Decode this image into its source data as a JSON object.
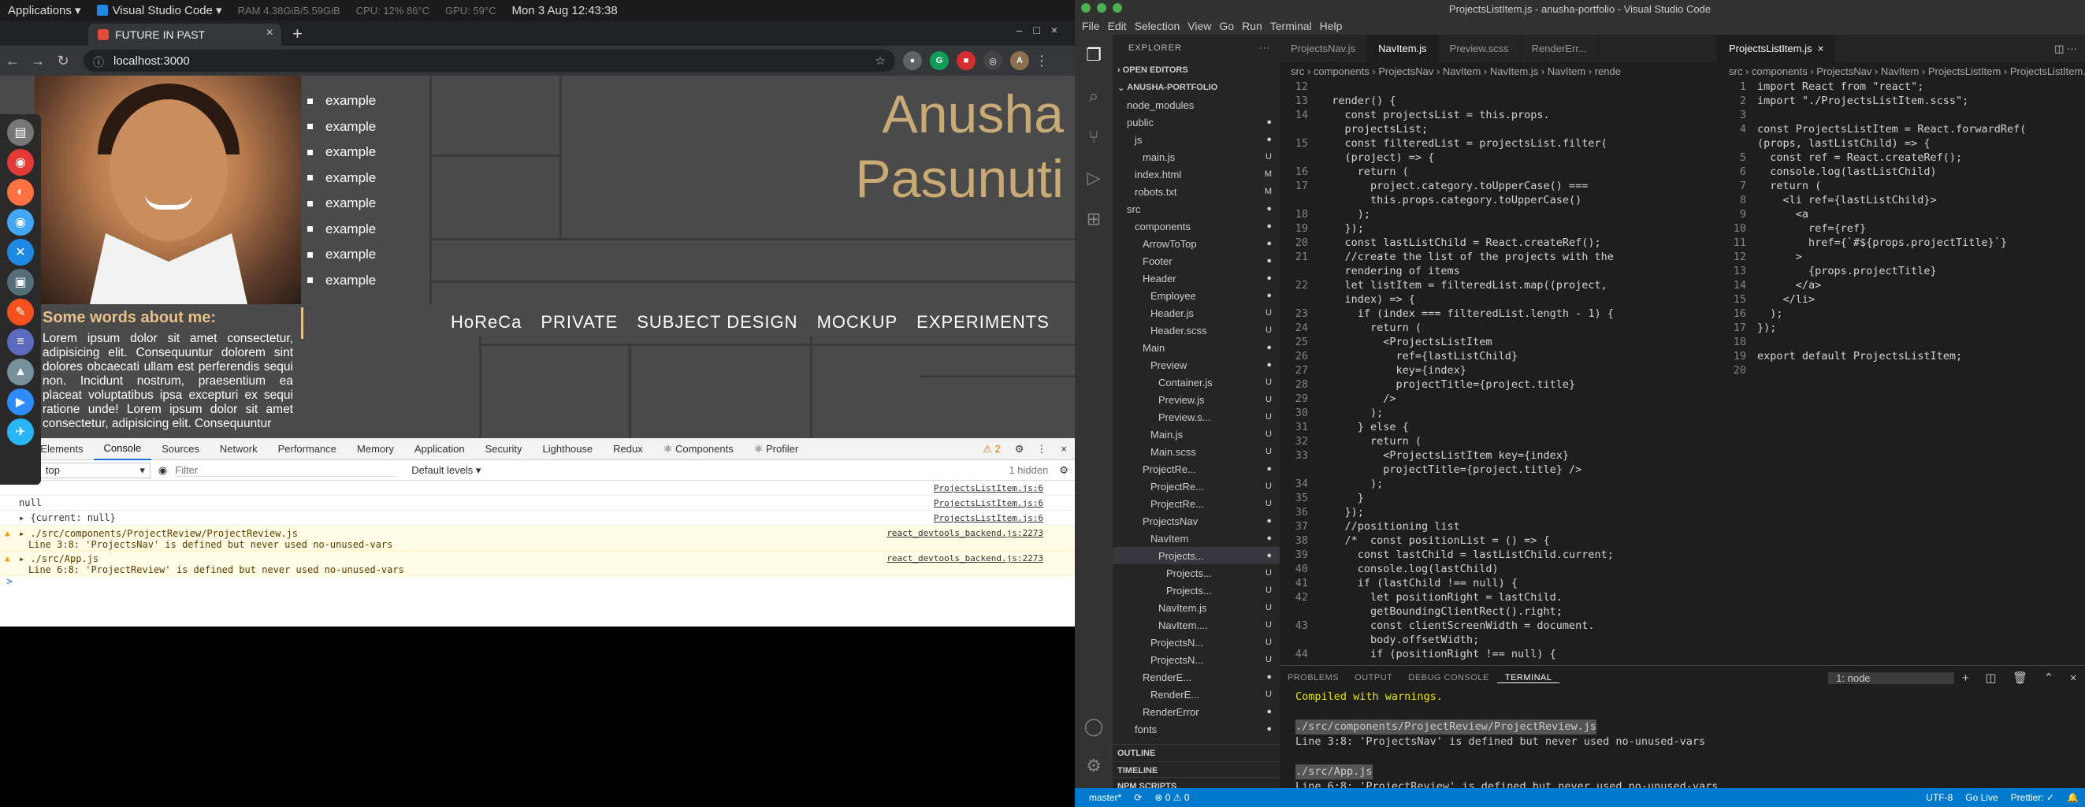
{
  "system": {
    "applications_menu": "Applications ▾",
    "active_app": "Visual Studio Code ▾",
    "ram": "RAM 4.38GiB/5.59GiB",
    "cpu": "CPU: 12% 86°C",
    "gpu": "GPU: 59°C",
    "clock": "Mon 3 Aug  12:43:38"
  },
  "browser": {
    "tab_title": "FUTURE IN PAST",
    "url": "localhost:3000"
  },
  "page": {
    "list_items": [
      "example",
      "example",
      "example",
      "example",
      "example",
      "example",
      "example",
      "example"
    ],
    "name_line1": "Anusha",
    "name_line2": "Pasunuti",
    "categories": [
      "HoReCa",
      "PRIVATE",
      "SUBJECT DESIGN",
      "MOCKUP",
      "EXPERIMENTS"
    ],
    "words_heading": "Some words about me:",
    "words_body": "Lorem ipsum dolor sit amet consectetur, adipisicing elit. Consequuntur dolorem sint dolores obcaecati ullam est perferendis sequi non. Incidunt nostrum, praesentium ea placeat voluptatibus ipsa excepturi ex sequi ratione unde! Lorem ipsum dolor sit amet consectetur, adipisicing elit. Consequuntur"
  },
  "devtools": {
    "tabs": [
      "Elements",
      "Console",
      "Sources",
      "Network",
      "Performance",
      "Memory",
      "Application",
      "Security",
      "Lighthouse",
      "Redux",
      "⚛ Components",
      "⚛ Profiler"
    ],
    "active_tab": "Console",
    "warning_count": "⚠ 2",
    "context": "top",
    "filter_placeholder": "Filter",
    "levels": "Default levels ▾",
    "hidden": "1 hidden",
    "logs": [
      {
        "text": "",
        "src": "ProjectsListItem.js:6"
      },
      {
        "text": "null",
        "src": "ProjectsListItem.js:6"
      },
      {
        "text": "▸ {current: null}",
        "src": "ProjectsListItem.js:6"
      }
    ],
    "warnings": [
      {
        "l1": "▸ ./src/components/ProjectReview/ProjectReview.js",
        "l2": "Line 3:8:  'ProjectsNav' is defined but never used  no-unused-vars",
        "src": "react_devtools_backend.js:2273"
      },
      {
        "l1": "▸ ./src/App.js",
        "l2": "Line 6:8:  'ProjectReview' is defined but never used  no-unused-vars",
        "src": "react_devtools_backend.js:2273"
      }
    ],
    "prompt": ">"
  },
  "vscode": {
    "title": "ProjectsListItem.js - anusha-portfolio - Visual Studio Code",
    "menu": [
      "File",
      "Edit",
      "Selection",
      "View",
      "Go",
      "Run",
      "Terminal",
      "Help"
    ],
    "explorer_title": "EXPLORER",
    "open_editors": "OPEN EDITORS",
    "project": "ANUSHA-PORTFOLIO",
    "tree": [
      {
        "label": "node_modules",
        "indent": 1,
        "status": ""
      },
      {
        "label": "public",
        "indent": 1,
        "status": "●"
      },
      {
        "label": "js",
        "indent": 2,
        "status": "●"
      },
      {
        "label": "main.js",
        "indent": 3,
        "status": "U"
      },
      {
        "label": "index.html",
        "indent": 2,
        "status": "M"
      },
      {
        "label": "robots.txt",
        "indent": 2,
        "status": "M"
      },
      {
        "label": "src",
        "indent": 1,
        "status": "●"
      },
      {
        "label": "components",
        "indent": 2,
        "status": "●"
      },
      {
        "label": "ArrowToTop",
        "indent": 3,
        "status": "●"
      },
      {
        "label": "Footer",
        "indent": 3,
        "status": "●"
      },
      {
        "label": "Header",
        "indent": 3,
        "status": "●"
      },
      {
        "label": "Employee",
        "indent": 4,
        "status": "●"
      },
      {
        "label": "Header.js",
        "indent": 4,
        "status": "U"
      },
      {
        "label": "Header.scss",
        "indent": 4,
        "status": "U"
      },
      {
        "label": "Main",
        "indent": 3,
        "status": "●"
      },
      {
        "label": "Preview",
        "indent": 4,
        "status": "●"
      },
      {
        "label": "Container.js",
        "indent": 5,
        "status": "U"
      },
      {
        "label": "Preview.js",
        "indent": 5,
        "status": "U"
      },
      {
        "label": "Preview.s...",
        "indent": 5,
        "status": "U"
      },
      {
        "label": "Main.js",
        "indent": 4,
        "status": "U"
      },
      {
        "label": "Main.scss",
        "indent": 4,
        "status": "U"
      },
      {
        "label": "ProjectRe...",
        "indent": 3,
        "status": "●"
      },
      {
        "label": "ProjectRe...",
        "indent": 4,
        "status": "U"
      },
      {
        "label": "ProjectRe...",
        "indent": 4,
        "status": "U"
      },
      {
        "label": "ProjectsNav",
        "indent": 3,
        "status": "●"
      },
      {
        "label": "NavItem",
        "indent": 4,
        "status": "●"
      },
      {
        "label": "Projects...",
        "indent": 5,
        "status": "●"
      },
      {
        "label": "Projects...",
        "indent": 6,
        "status": "U"
      },
      {
        "label": "Projects...",
        "indent": 6,
        "status": "U"
      },
      {
        "label": "NavItem.js",
        "indent": 5,
        "status": "U"
      },
      {
        "label": "NavItem....",
        "indent": 5,
        "status": "U"
      },
      {
        "label": "ProjectsN...",
        "indent": 4,
        "status": "U"
      },
      {
        "label": "ProjectsN...",
        "indent": 4,
        "status": "U"
      },
      {
        "label": "RenderE...",
        "indent": 3,
        "status": "●"
      },
      {
        "label": "RenderE...",
        "indent": 4,
        "status": "U"
      },
      {
        "label": "RenderError",
        "indent": 3,
        "status": "●"
      },
      {
        "label": "fonts",
        "indent": 2,
        "status": "●"
      }
    ],
    "outline": "OUTLINE",
    "timeline": "TIMELINE",
    "npm": "NPM SCRIPTS",
    "left_tabs": [
      "ProjectsNav.js",
      "NavItem.js",
      "Preview.scss",
      "RenderErr..."
    ],
    "left_active": "NavItem.js",
    "left_crumbs": "src › components › ProjectsNav › NavItem › NavItem.js › NavItem › rende",
    "left_code": [
      [
        "12",
        ""
      ],
      [
        "13",
        "  render() {"
      ],
      [
        "14",
        "    const projectsList = this.props."
      ],
      [
        "",
        "    projectsList;"
      ],
      [
        "15",
        "    const filteredList = projectsList.filter("
      ],
      [
        "",
        "    (project) => {"
      ],
      [
        "16",
        "      return ("
      ],
      [
        "17",
        "        project.category.toUpperCase() ==="
      ],
      [
        "",
        "        this.props.category.toUpperCase()"
      ],
      [
        "18",
        "      );"
      ],
      [
        "19",
        "    });"
      ],
      [
        "20",
        "    const lastListChild = React.createRef();"
      ],
      [
        "21",
        "    //create the list of the projects with the"
      ],
      [
        "",
        "    rendering of items"
      ],
      [
        "22",
        "    let listItem = filteredList.map((project,"
      ],
      [
        "",
        "    index) => {"
      ],
      [
        "23",
        "      if (index === filteredList.length - 1) {"
      ],
      [
        "24",
        "        return ("
      ],
      [
        "25",
        "          <ProjectsListItem"
      ],
      [
        "26",
        "            ref={lastListChild}"
      ],
      [
        "27",
        "            key={index}"
      ],
      [
        "28",
        "            projectTitle={project.title}"
      ],
      [
        "29",
        "          />"
      ],
      [
        "30",
        "        );"
      ],
      [
        "31",
        "      } else {"
      ],
      [
        "32",
        "        return ("
      ],
      [
        "33",
        "          <ProjectsListItem key={index}"
      ],
      [
        "",
        "          projectTitle={project.title} />"
      ],
      [
        "34",
        "        );"
      ],
      [
        "35",
        "      }"
      ],
      [
        "36",
        "    });"
      ],
      [
        "37",
        "    //positioning list"
      ],
      [
        "38",
        "    /*  const positionList = () => {"
      ],
      [
        "39",
        "      const lastChild = lastListChild.current;"
      ],
      [
        "40",
        "      console.log(lastChild)"
      ],
      [
        "41",
        "      if (lastChild !== null) {"
      ],
      [
        "42",
        "        let positionRight = lastChild."
      ],
      [
        "",
        "        getBoundingClientRect().right;"
      ],
      [
        "43",
        "        const clientScreenWidth = document."
      ],
      [
        "",
        "        body.offsetWidth;"
      ],
      [
        "44",
        "        if (positionRight !== null) {"
      ]
    ],
    "right_tab": "ProjectsListItem.js",
    "right_crumbs": "src › components › ProjectsNav › NavItem › ProjectsListItem › ProjectsListItem.js ›",
    "right_code": [
      [
        "1",
        "import React from \"react\";"
      ],
      [
        "2",
        "import \"./ProjectsListItem.scss\";"
      ],
      [
        "3",
        ""
      ],
      [
        "4",
        "const ProjectsListItem = React.forwardRef("
      ],
      [
        "",
        "(props, lastListChild) => {"
      ],
      [
        "5",
        "  const ref = React.createRef();"
      ],
      [
        "6",
        "  console.log(lastListChild)"
      ],
      [
        "7",
        "  return ("
      ],
      [
        "8",
        "    <li ref={lastListChild}>"
      ],
      [
        "9",
        "      <a"
      ],
      [
        "10",
        "        ref={ref}"
      ],
      [
        "11",
        "        href={`#${props.projectTitle}`}"
      ],
      [
        "12",
        "      >"
      ],
      [
        "13",
        "        {props.projectTitle}"
      ],
      [
        "14",
        "      </a>"
      ],
      [
        "15",
        "    </li>"
      ],
      [
        "16",
        "  );"
      ],
      [
        "17",
        "});"
      ],
      [
        "18",
        ""
      ],
      [
        "19",
        "export default ProjectsListItem;"
      ],
      [
        "20",
        ""
      ]
    ],
    "panel_tabs": [
      "PROBLEMS",
      "OUTPUT",
      "DEBUG CONSOLE",
      "TERMINAL"
    ],
    "panel_active": "TERMINAL",
    "terminal_select": "1: node",
    "terminal": [
      "Compiled with warnings.",
      "",
      "./src/components/ProjectReview/ProjectReview.js",
      "  Line 3:8:  'ProjectsNav' is defined but never used  no-unused-vars",
      "",
      "./src/App.js",
      "  Line 6:8:  'ProjectReview' is defined but never used  no-unused-vars"
    ],
    "status": {
      "branch": "master*",
      "sync": "⟳",
      "problems": "⊗ 0  ⚠ 0",
      "encoding": "UTF-8",
      "golive": "Go Live",
      "prettier": "Prettier: ✓"
    }
  }
}
